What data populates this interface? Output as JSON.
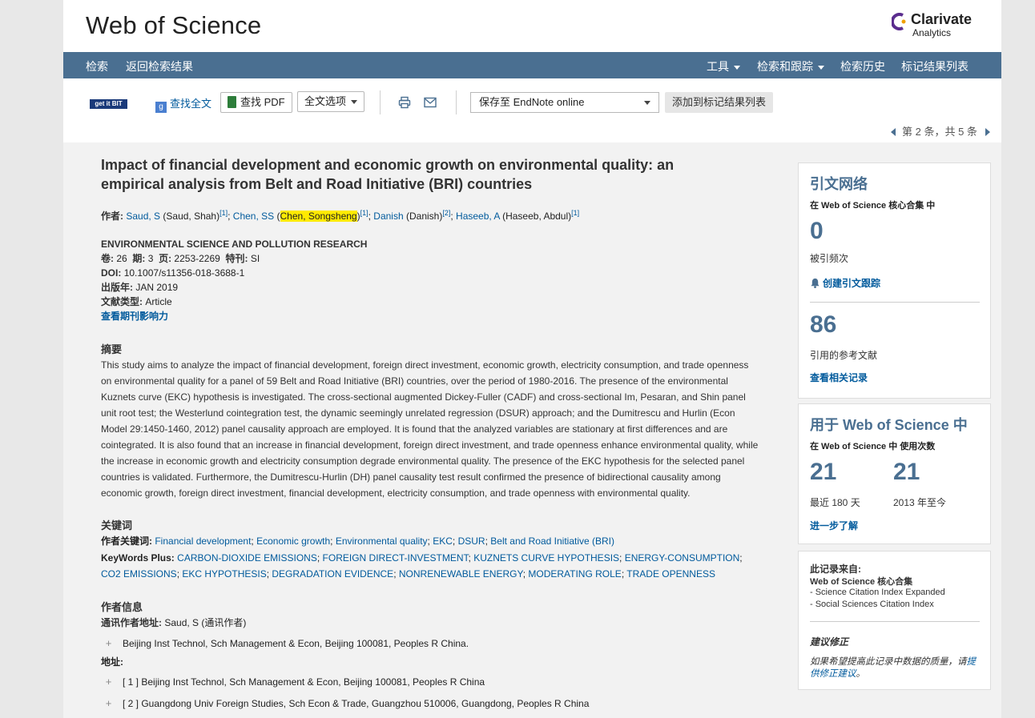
{
  "header": {
    "brand": "Web of Science",
    "vendor_line1": "Clarivate",
    "vendor_line2": "Analytics"
  },
  "nav": {
    "left": [
      "检索",
      "返回检索结果"
    ],
    "tools": "工具",
    "search_track": "检索和跟踪",
    "history": "检索历史",
    "marked_list": "标记结果列表"
  },
  "toolbar": {
    "getit": "get it BIT",
    "find_fulltext": "查找全文",
    "find_pdf": "查找 PDF",
    "fulltext_options": "全文选项",
    "save_to": "保存至 EndNote online",
    "add_marked": "添加到标记结果列表",
    "pager": "第 2 条，共 5 条"
  },
  "record": {
    "title": "Impact of financial development and economic growth on environmental quality: an empirical analysis from Belt and Road Initiative (BRI) countries",
    "authors_label": "作者:",
    "authors": [
      {
        "short": "Saud, S",
        "full": "(Saud, Shah)",
        "ref": "[1]"
      },
      {
        "short": "Chen, SS",
        "full_highlight": "Chen, Songsheng",
        "ref": "[1]"
      },
      {
        "short": "Danish",
        "full": "(Danish)",
        "ref": "[2]"
      },
      {
        "short": "Haseeb, A",
        "full": "(Haseeb, Abdul)",
        "ref": "[1]"
      }
    ],
    "journal": "ENVIRONMENTAL SCIENCE AND POLLUTION RESEARCH",
    "volume_label": "卷:",
    "volume": "26",
    "issue_label": "期:",
    "issue": "3",
    "pages_label": "页:",
    "pages": "2253-2269",
    "special_label": "特刊:",
    "special": "SI",
    "doi_label": "DOI:",
    "doi": "10.1007/s11356-018-3688-1",
    "pubdate_label": "出版年:",
    "pubdate": "JAN 2019",
    "doctype_label": "文献类型:",
    "doctype": "Article",
    "journal_impact": "查看期刊影响力",
    "abstract_heading": "摘要",
    "abstract": "This study aims to analyze the impact of financial development, foreign direct investment, economic growth, electricity consumption, and trade openness on environmental quality for a panel of 59 Belt and Road Initiative (BRI) countries, over the period of 1980-2016. The presence of the environmental Kuznets curve (EKC) hypothesis is investigated. The cross-sectional augmented Dickey-Fuller (CADF) and cross-sectional Im, Pesaran, and Shin panel unit root test; the Westerlund cointegration test, the dynamic seemingly unrelated regression (DSUR) approach; and the Dumitrescu and Hurlin (Econ Model 29:1450-1460, 2012) panel causality approach are employed. It is found that the analyzed variables are stationary at first differences and are cointegrated. It is also found that an increase in financial development, foreign direct investment, and trade openness enhance environmental quality, while the increase in economic growth and electricity consumption degrade environmental quality. The presence of the EKC hypothesis for the selected panel countries is validated. Furthermore, the Dumitrescu-Hurlin (DH) panel causality test result confirmed the presence of bidirectional causality among economic growth, foreign direct investment, financial development, electricity consumption, and trade openness with environmental quality.",
    "keywords_heading": "关键词",
    "author_kw_label": "作者关键词:",
    "author_keywords": [
      "Financial development",
      "Economic growth",
      "Environmental quality",
      "EKC",
      "DSUR",
      "Belt and Road Initiative (BRI)"
    ],
    "kwplus_label": "KeyWords Plus:",
    "keywords_plus": [
      "CARBON-DIOXIDE EMISSIONS",
      "FOREIGN DIRECT-INVESTMENT",
      "KUZNETS CURVE HYPOTHESIS",
      "ENERGY-CONSUMPTION",
      "CO2 EMISSIONS",
      "EKC HYPOTHESIS",
      "DEGRADATION EVIDENCE",
      "NONRENEWABLE ENERGY",
      "MODERATING ROLE",
      "TRADE OPENNESS"
    ],
    "author_info_heading": "作者信息",
    "corr_label": "通讯作者地址:",
    "corr_author": "Saud, S (通讯作者)",
    "corr_address": "Beijing Inst Technol, Sch Management & Econ, Beijing 100081, Peoples R China.",
    "address_label": "地址:",
    "addresses": [
      "[ 1 ] Beijing Inst Technol, Sch Management & Econ, Beijing 100081, Peoples R China",
      "[ 2 ] Guangdong Univ Foreign Studies, Sch Econ & Trade, Guangzhou 510006, Guangdong, Peoples R China"
    ]
  },
  "citation_panel": {
    "heading": "引文网络",
    "sub": "在 Web of Science 核心合集 中",
    "times_cited": "0",
    "times_cited_label": "被引频次",
    "create_alert": "创建引文跟踪",
    "refs": "86",
    "refs_label": "引用的参考文献",
    "related": "查看相关记录"
  },
  "usage_panel": {
    "heading": "用于 Web of Science 中",
    "sub": "在 Web of Science 中 使用次数",
    "last180": "21",
    "last180_label": "最近 180 天",
    "since2013": "21",
    "since2013_label": "2013 年至今",
    "learn_more": "进一步了解"
  },
  "source_panel": {
    "heading": "此记录来自:",
    "collection": "Web of Science 核心合集",
    "index1": "- Science Citation Index Expanded",
    "index2": "- Social Sciences Citation Index",
    "suggest_heading": "建议修正",
    "suggest_text": "如果希望提高此记录中数据的质量，请",
    "suggest_link": "提供修正建议",
    "suggest_end": "。"
  }
}
